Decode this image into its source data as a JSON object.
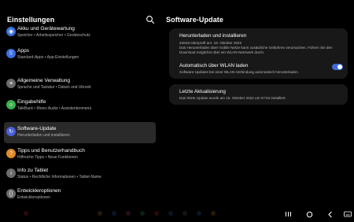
{
  "left_panel": {
    "title": "Einstellungen",
    "items": [
      {
        "label": "Akku und Gerätewartung",
        "sub": "Speicher • Arbeitsspeicher • Geräteschutz",
        "icon": "battery-care-icon",
        "color": "#3b6fd8",
        "selected": false
      },
      {
        "label": "Apps",
        "sub": "Standard-Apps • App-Einstellungen",
        "icon": "apps-icon",
        "color": "#3c6ee0",
        "selected": false
      },
      {
        "label": "Allgemeine Verwaltung",
        "sub": "Sprache und Tastatur • Datum und Uhrzeit",
        "icon": "general-management-icon",
        "color": "#6b6b6b",
        "selected": false
      },
      {
        "label": "Eingabehilfe",
        "sub": "TalkBack • Mono-Audio • Assistentenmenü",
        "icon": "accessibility-icon",
        "color": "#3cae4e",
        "selected": false
      },
      {
        "label": "Software-Update",
        "sub": "Herunterladen und installieren",
        "icon": "software-update-icon",
        "color": "#4a5fd8",
        "selected": true
      },
      {
        "label": "Tipps und Benutzerhandbuch",
        "sub": "Hilfreiche Tipps • Neue Funktionen",
        "icon": "tips-icon",
        "color": "#e08a2a",
        "selected": false
      },
      {
        "label": "Info zu Tablet",
        "sub": "Status • Rechtliche Informationen • Tablet-Name",
        "icon": "info-icon",
        "color": "#6b6b6b",
        "selected": false
      },
      {
        "label": "Entwickleroptionen",
        "sub": "Entwickleroptionen",
        "icon": "developer-options-icon",
        "color": "#6b6b6b",
        "selected": false
      }
    ]
  },
  "right_panel": {
    "title": "Software-Update",
    "download": {
      "title": "Herunterladen und installieren",
      "last_check": "Zuletzt überprüft am: 18. Oktober 2022",
      "desc": "Das Herunterladen über mobile Netze kann zusätzliche Gebühren verursachen. Führen Sie den Download möglichst über ein WLAN-Netzwerk durch."
    },
    "auto_wlan": {
      "title": "Automatisch über WLAN laden",
      "desc": "Software-Updates bei einer WLAN-Verbindung automatisch herunterladen.",
      "enabled": true
    },
    "last_update": {
      "title": "Letzte Aktualisierung",
      "desc": "Das letzte Update wurde am 15. Oktober 2022 um 07:04 installiert."
    }
  },
  "navbar": {
    "buttons": [
      "recent-apps-icon",
      "home-icon",
      "back-icon",
      "keyboard-icon"
    ]
  },
  "colors": {
    "background": "#000000",
    "card": "#181818",
    "selected": "#2a2a2a",
    "accent": "#3e6bd8"
  }
}
